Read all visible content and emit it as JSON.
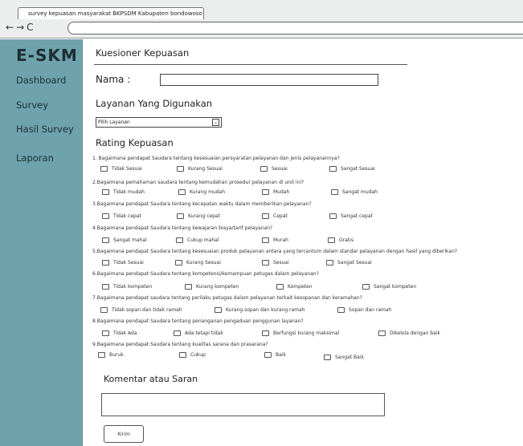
{
  "browser": {
    "tab_title": "survey kepuasan masyarakat BKPSDM Kabupaten bondowoso",
    "nav_icons": [
      "back-arrow-icon",
      "forward-arrow-icon",
      "refresh-icon"
    ]
  },
  "sidebar": {
    "logo": "E-SKM",
    "items": [
      {
        "label": "Dashboard"
      },
      {
        "label": "Survey"
      },
      {
        "label": "Hasil Survey"
      },
      {
        "label": "Laporan"
      }
    ]
  },
  "form": {
    "title": "Kuesioner Kepuasan",
    "name_label": "Nama :",
    "name_value": "",
    "layanan_title": "Layanan Yang Digunakan",
    "layanan_select": "Pilih Layanan",
    "rating_title": "Rating Kepuasan",
    "questions": [
      {
        "text": "1. Bagaimana pendapat Saudara tentang kesesuaian persyaratan pelayanan dan jenis pelayanannya?",
        "options": [
          "Tidak Sesuai",
          "Kurang Sesuai",
          "Sesuai",
          "Sangat Sesuai"
        ]
      },
      {
        "text": "2.Bagaimana pemahaman saudara tentang kemudahan prosedur pelayanan di unit ini?",
        "options": [
          "Tidak mudah",
          "Kurang mudah",
          "Mudah",
          "Sangat mudah"
        ]
      },
      {
        "text": "3.Bagaimana pendapat Saudara tentang kecepatan waktu dalam memberikan pelayanan?",
        "options": [
          "Tidak cepat",
          "Kurang cepat",
          "Cepat",
          "Sangat cepat"
        ]
      },
      {
        "text": "4.Bagaimana pendapat Saudara tentang kewajaran biaya/tarif pelayanan?",
        "options": [
          "Sangat mahal",
          "Cukup mahal",
          "Murah",
          "Gratis"
        ]
      },
      {
        "text": "5.Bagaimana pendapat Saudara tentang kesesuaian produk pelayanan antara yang tercantum dalam standar pelayanan dengan hasil yang diberikan?",
        "options": [
          "Tidak Sesuai",
          "Kurang Sesuai",
          "Sesuai",
          "Sangat Sesuai"
        ]
      },
      {
        "text": "6.Bagaimana pendapat Saudara tentang kompetensi/kemampuan petugas dalam pelayanan?",
        "options": [
          "Tidak kompeten",
          "Kurang kompeten",
          "Kompeten",
          "Sangat kompeten"
        ]
      },
      {
        "text": "7.Bagaimana pendapat saudara tentang perilaku petugas dalam pelayanan terkait kesopanan dan keramahan?",
        "options": [
          "Tidak sopan dan tidak ramah",
          "Kurang sopan dan kurang ramah",
          "Sopan dan ramah"
        ]
      },
      {
        "text": "8.Bagaimana pendapat Saudara tentang penanganan pengaduan penggunan layanan?",
        "options": [
          "Tidak Ada",
          "Ada tetapi tidak",
          "Berfungsi kurang maksimal",
          "Dikelola dengan baik"
        ]
      },
      {
        "text": "9.Bagaimana pendapat Saudara tentang kualitas sarana dan prasarana?",
        "options": [
          "Buruk",
          "Cukup",
          "Baik",
          "Sangat Baik"
        ]
      }
    ],
    "komentar_title": "Komentar atau Saran",
    "komentar_value": "",
    "submit_label": "Kirim"
  }
}
